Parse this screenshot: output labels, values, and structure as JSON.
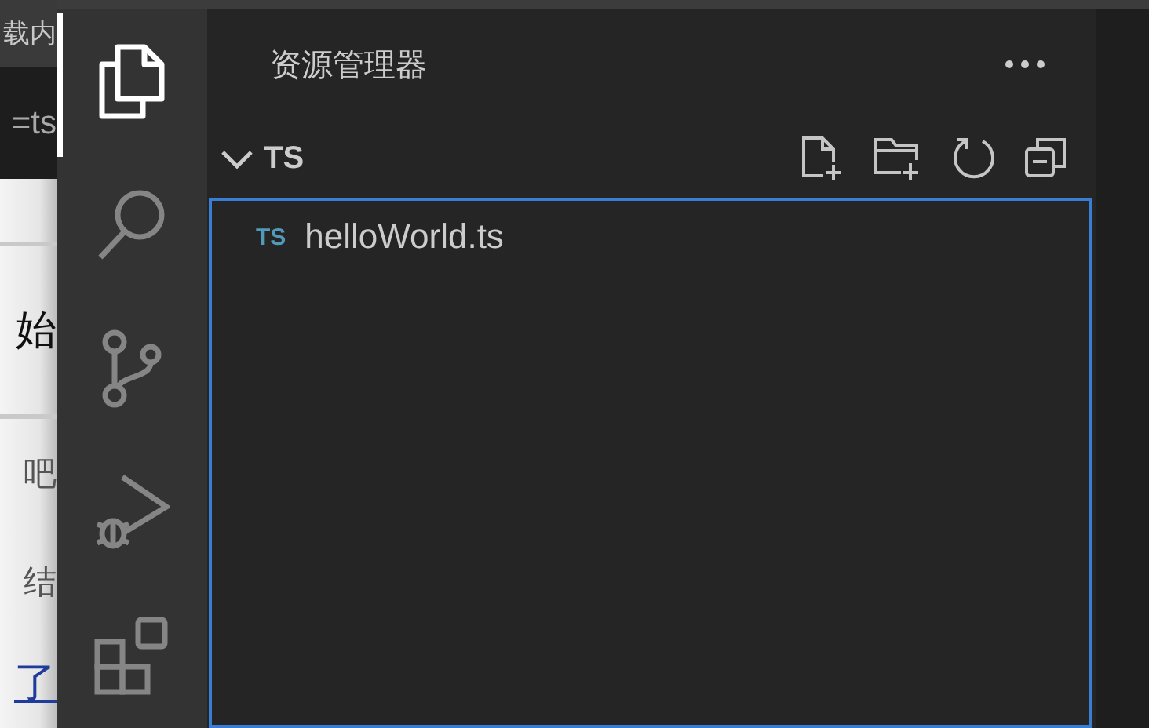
{
  "browser_strip": [
    {
      "kind": "header",
      "text": "载内"
    },
    {
      "kind": "url",
      "text": "=ts"
    },
    {
      "kind": "heading",
      "text": "始"
    },
    {
      "kind": "body",
      "text": "吧"
    },
    {
      "kind": "body",
      "text": "结"
    },
    {
      "kind": "link",
      "text": "了"
    }
  ],
  "activity_bar": {
    "items": [
      {
        "kind": "explorer",
        "selected": true
      },
      {
        "kind": "search",
        "selected": false
      },
      {
        "kind": "source-control",
        "selected": false
      },
      {
        "kind": "run-debug",
        "selected": false
      },
      {
        "kind": "extensions",
        "selected": false
      }
    ]
  },
  "sidebar": {
    "title": "资源管理器",
    "section": {
      "label": "TS",
      "expanded": true
    },
    "files": [
      {
        "badge": "TS",
        "name": "helloWorld.ts"
      }
    ]
  }
}
